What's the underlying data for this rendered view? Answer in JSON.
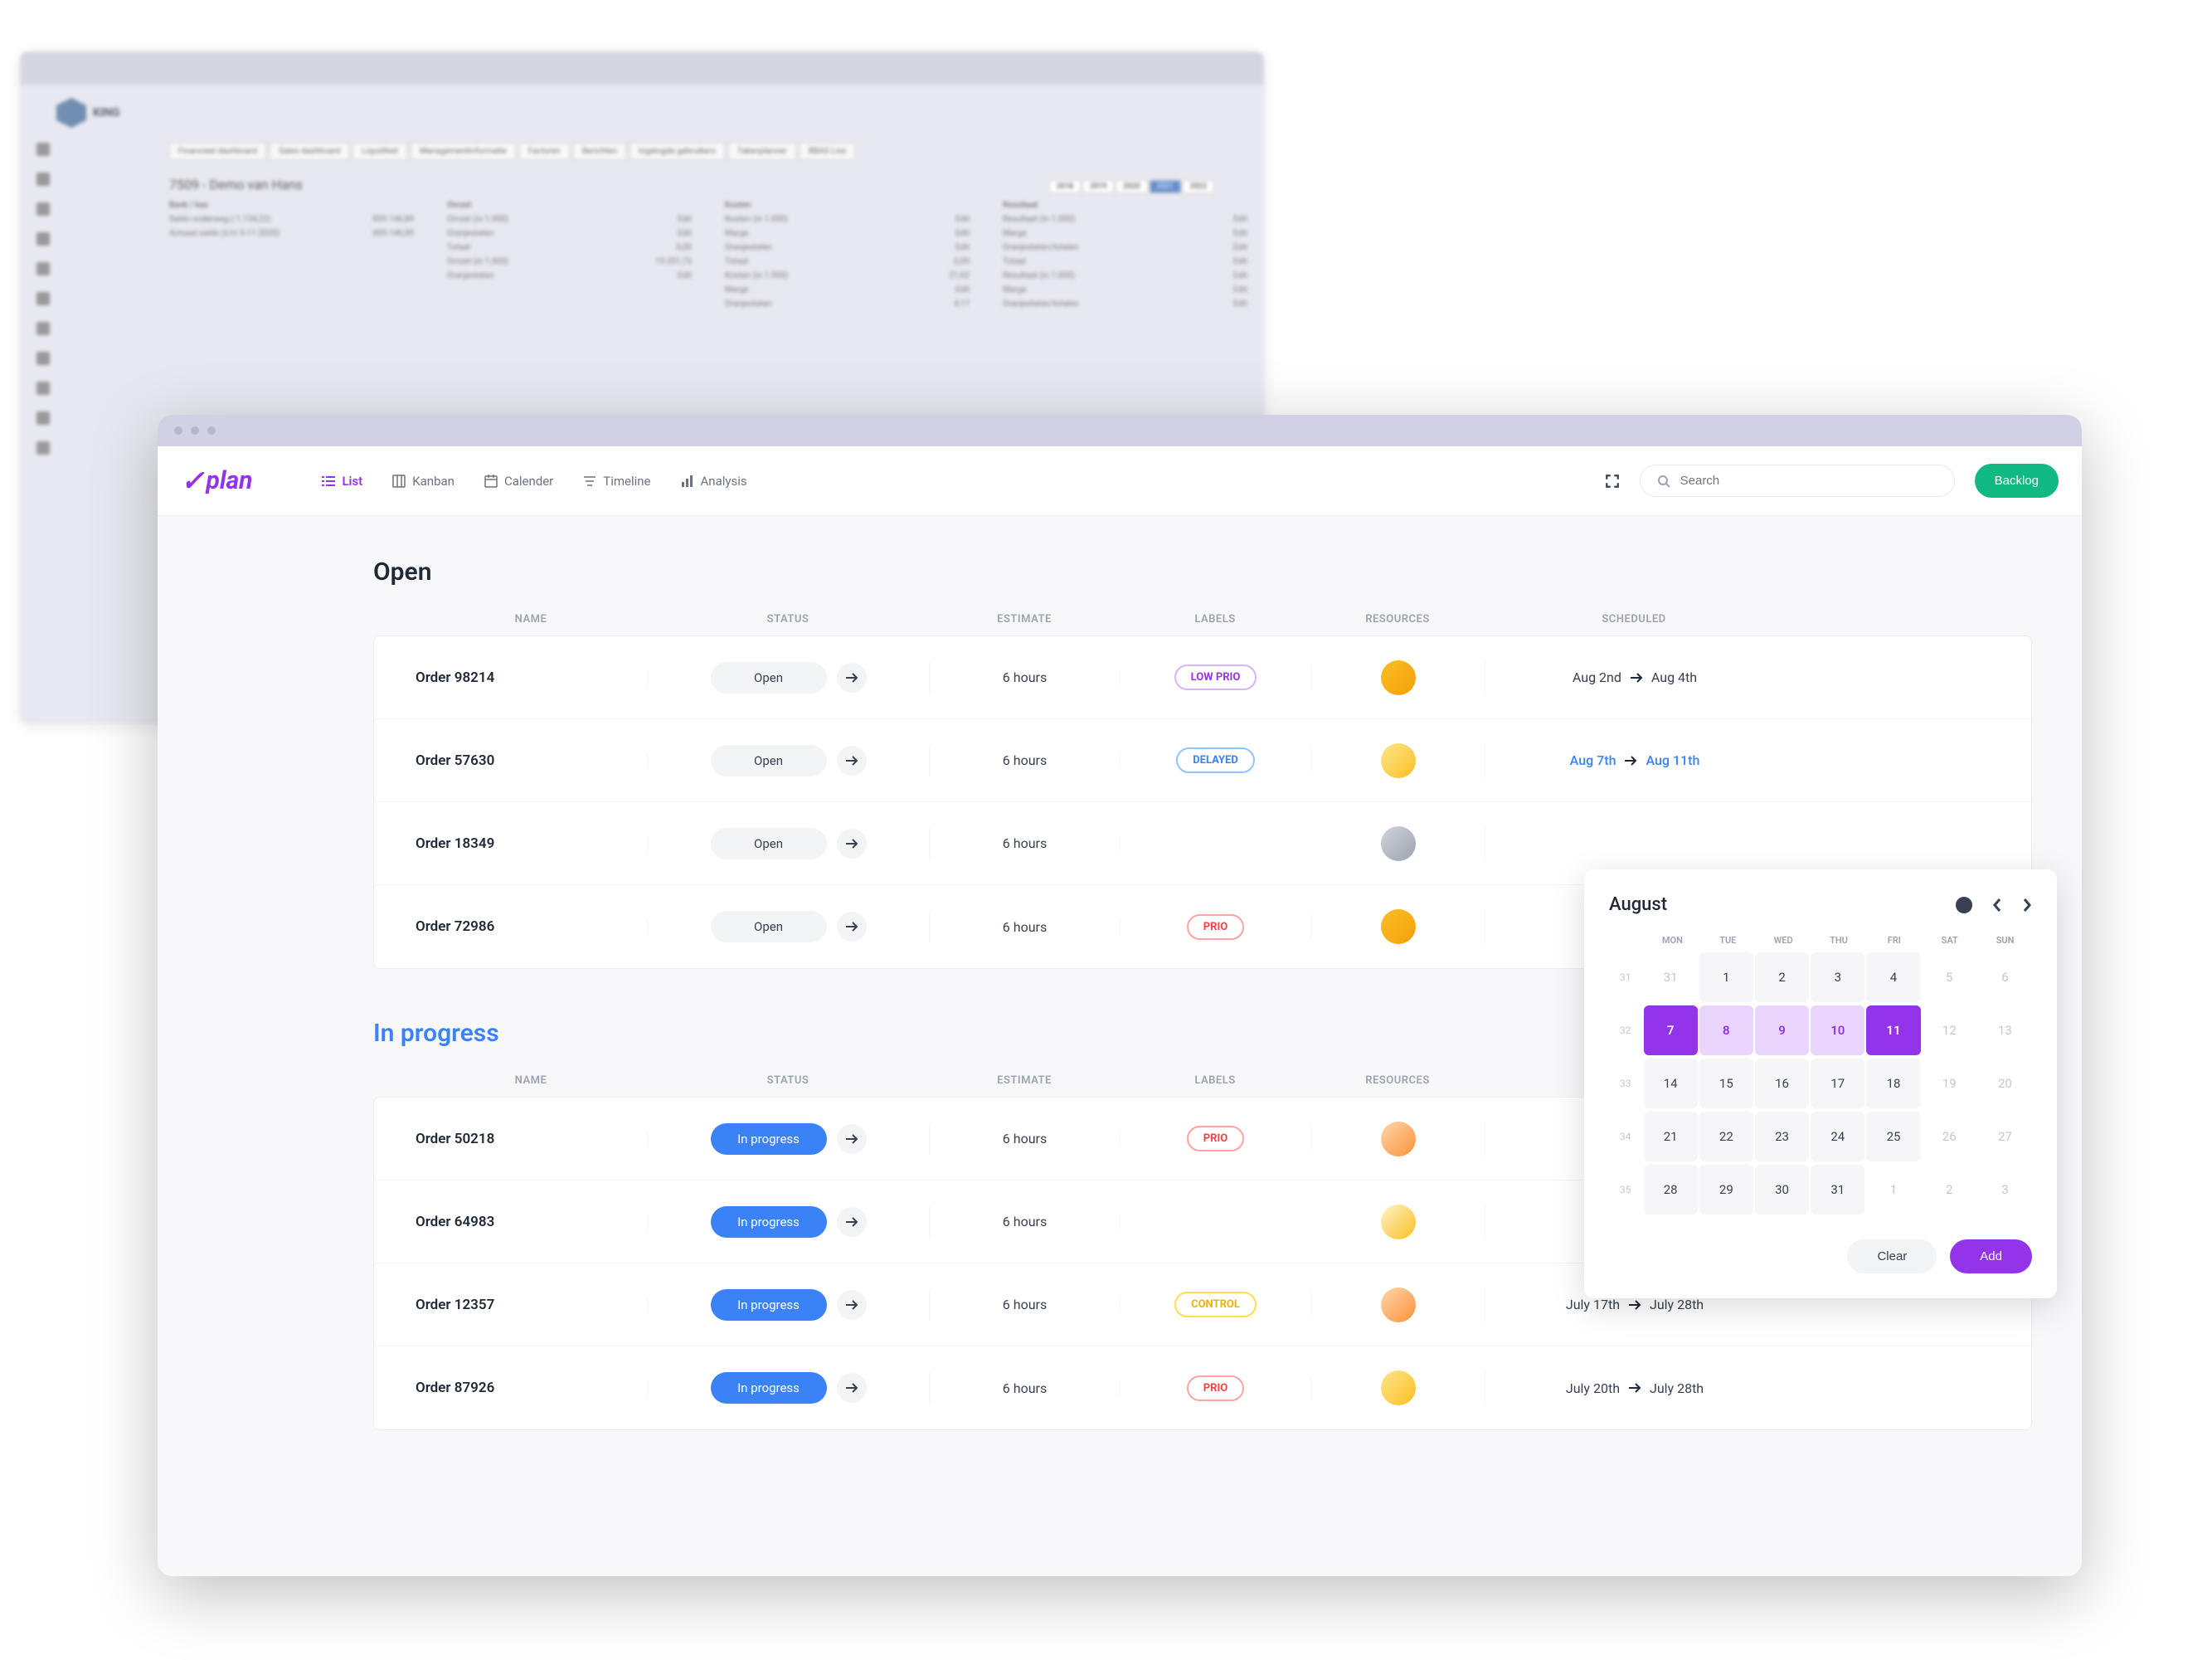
{
  "bg": {
    "logo": "KING",
    "tabs": [
      "Financieel dashboard",
      "Sales dashboard",
      "Liquiditeit",
      "Managementinformatie",
      "Facturen",
      "Berichten",
      "Ingelogde gebruikers",
      "Takenplanner",
      "BBAS Live"
    ],
    "title": "7509 - Demo van Hans",
    "years": [
      "2018",
      "2019",
      "2020",
      "2021",
      "2022"
    ],
    "cols": [
      {
        "h": "Bank / kas",
        "items": [
          "Saldo onderweg (-1.134,22)",
          "Actueel saldo (t/m 5-11-2020)"
        ],
        "val": "859.146,89"
      },
      {
        "h": "Omzet",
        "items": [
          "Omzet (in 1.000)",
          "Oranjestaten",
          "Totaal",
          "Omzet (in 1.000)",
          "Oranjestaten"
        ],
        "vals": [
          "Edit",
          "Edit",
          "0,00",
          "19.351,73",
          "Edit"
        ]
      },
      {
        "h": "Kosten",
        "items": [
          "Kosten (in 1.000)",
          "Marge",
          "Oranjestaten",
          "Totaal",
          "Kosten (in 1.000)",
          "Marge",
          "Oranjestaten"
        ],
        "vals": [
          "Edit",
          "Edit",
          "Edit",
          "0,00",
          "21,62",
          "Edit",
          "4,17"
        ]
      },
      {
        "h": "Resultaat",
        "items": [
          "Resultaat (in 1.000)",
          "Marge",
          "Oranjestaten/totalen",
          "Totaal",
          "Resultaat (in 1.000)",
          "Marge",
          "Oranjestaten/totalen"
        ],
        "vals": [
          "Edit",
          "Edit",
          "Edit",
          "Edit",
          "Edit",
          "Edit",
          "Edit"
        ]
      }
    ]
  },
  "app": {
    "logo": "plan",
    "tabs": {
      "list": "List",
      "kanban": "Kanban",
      "calendar": "Calender",
      "timeline": "Timeline",
      "analysis": "Analysis"
    },
    "search_placeholder": "Search",
    "backlog": "Backlog"
  },
  "headers": {
    "name": "NAME",
    "status": "STATUS",
    "estimate": "ESTIMATE",
    "labels": "LABELS",
    "resources": "RESOURCES",
    "scheduled": "SCHEDULED"
  },
  "sections": [
    {
      "title": "Open",
      "class": "",
      "rows": [
        {
          "name": "Order 98214",
          "status": "Open",
          "status_class": "",
          "estimate": "6 hours",
          "label": "LOW PRIO",
          "label_class": "label-lowprio",
          "avatar": "a1",
          "sched_from": "Aug 2nd",
          "sched_to": "Aug 4th",
          "sched_class": ""
        },
        {
          "name": "Order 57630",
          "status": "Open",
          "status_class": "",
          "estimate": "6 hours",
          "label": "DELAYED",
          "label_class": "label-delayed",
          "avatar": "a2",
          "sched_from": "Aug 7th",
          "sched_to": "Aug 11th",
          "sched_class": "blue"
        },
        {
          "name": "Order 18349",
          "status": "Open",
          "status_class": "",
          "estimate": "6 hours",
          "label": "",
          "label_class": "",
          "avatar": "a3",
          "sched_from": "",
          "sched_to": "",
          "sched_class": ""
        },
        {
          "name": "Order 72986",
          "status": "Open",
          "status_class": "",
          "estimate": "6 hours",
          "label": "PRIO",
          "label_class": "label-prio",
          "avatar": "a1",
          "sched_from": "",
          "sched_to": "",
          "sched_class": ""
        }
      ]
    },
    {
      "title": "In progress",
      "class": "blue",
      "rows": [
        {
          "name": "Order 50218",
          "status": "In progress",
          "status_class": "blue",
          "estimate": "6 hours",
          "label": "PRIO",
          "label_class": "label-prio",
          "avatar": "a4",
          "sched_from": "",
          "sched_to": "",
          "sched_class": ""
        },
        {
          "name": "Order 64983",
          "status": "In progress",
          "status_class": "blue",
          "estimate": "6 hours",
          "label": "",
          "label_class": "",
          "avatar": "a5",
          "sched_from": "",
          "sched_to": "",
          "sched_class": ""
        },
        {
          "name": "Order 12357",
          "status": "In progress",
          "status_class": "blue",
          "estimate": "6 hours",
          "label": "CONTROL",
          "label_class": "label-control",
          "avatar": "a4",
          "sched_from": "July 17th",
          "sched_to": "July 28th",
          "sched_class": ""
        },
        {
          "name": "Order 87926",
          "status": "In progress",
          "status_class": "blue",
          "estimate": "6 hours",
          "label": "PRIO",
          "label_class": "label-prio",
          "avatar": "a2",
          "sched_from": "July 20th",
          "sched_to": "July 28th",
          "sched_class": ""
        }
      ]
    }
  ],
  "calendar": {
    "month": "August",
    "days": [
      "MON",
      "TUE",
      "WED",
      "THU",
      "FRI",
      "SAT",
      "SUN"
    ],
    "weeks": [
      {
        "num": "31",
        "days": [
          {
            "n": "31",
            "c": "dim"
          },
          {
            "n": "1",
            "c": ""
          },
          {
            "n": "2",
            "c": ""
          },
          {
            "n": "3",
            "c": ""
          },
          {
            "n": "4",
            "c": ""
          },
          {
            "n": "5",
            "c": "dim"
          },
          {
            "n": "6",
            "c": "dim"
          }
        ]
      },
      {
        "num": "32",
        "days": [
          {
            "n": "7",
            "c": "sel-start"
          },
          {
            "n": "8",
            "c": "sel-mid"
          },
          {
            "n": "9",
            "c": "sel-mid"
          },
          {
            "n": "10",
            "c": "sel-mid"
          },
          {
            "n": "11",
            "c": "sel-end"
          },
          {
            "n": "12",
            "c": "dim"
          },
          {
            "n": "13",
            "c": "dim"
          }
        ]
      },
      {
        "num": "33",
        "days": [
          {
            "n": "14",
            "c": ""
          },
          {
            "n": "15",
            "c": ""
          },
          {
            "n": "16",
            "c": ""
          },
          {
            "n": "17",
            "c": ""
          },
          {
            "n": "18",
            "c": ""
          },
          {
            "n": "19",
            "c": "dim"
          },
          {
            "n": "20",
            "c": "dim"
          }
        ]
      },
      {
        "num": "34",
        "days": [
          {
            "n": "21",
            "c": ""
          },
          {
            "n": "22",
            "c": ""
          },
          {
            "n": "23",
            "c": ""
          },
          {
            "n": "24",
            "c": ""
          },
          {
            "n": "25",
            "c": ""
          },
          {
            "n": "26",
            "c": "dim"
          },
          {
            "n": "27",
            "c": "dim"
          }
        ]
      },
      {
        "num": "35",
        "days": [
          {
            "n": "28",
            "c": ""
          },
          {
            "n": "29",
            "c": ""
          },
          {
            "n": "30",
            "c": ""
          },
          {
            "n": "31",
            "c": ""
          },
          {
            "n": "1",
            "c": "dim"
          },
          {
            "n": "2",
            "c": "dim"
          },
          {
            "n": "3",
            "c": "dim"
          }
        ]
      }
    ],
    "clear": "Clear",
    "add": "Add"
  }
}
